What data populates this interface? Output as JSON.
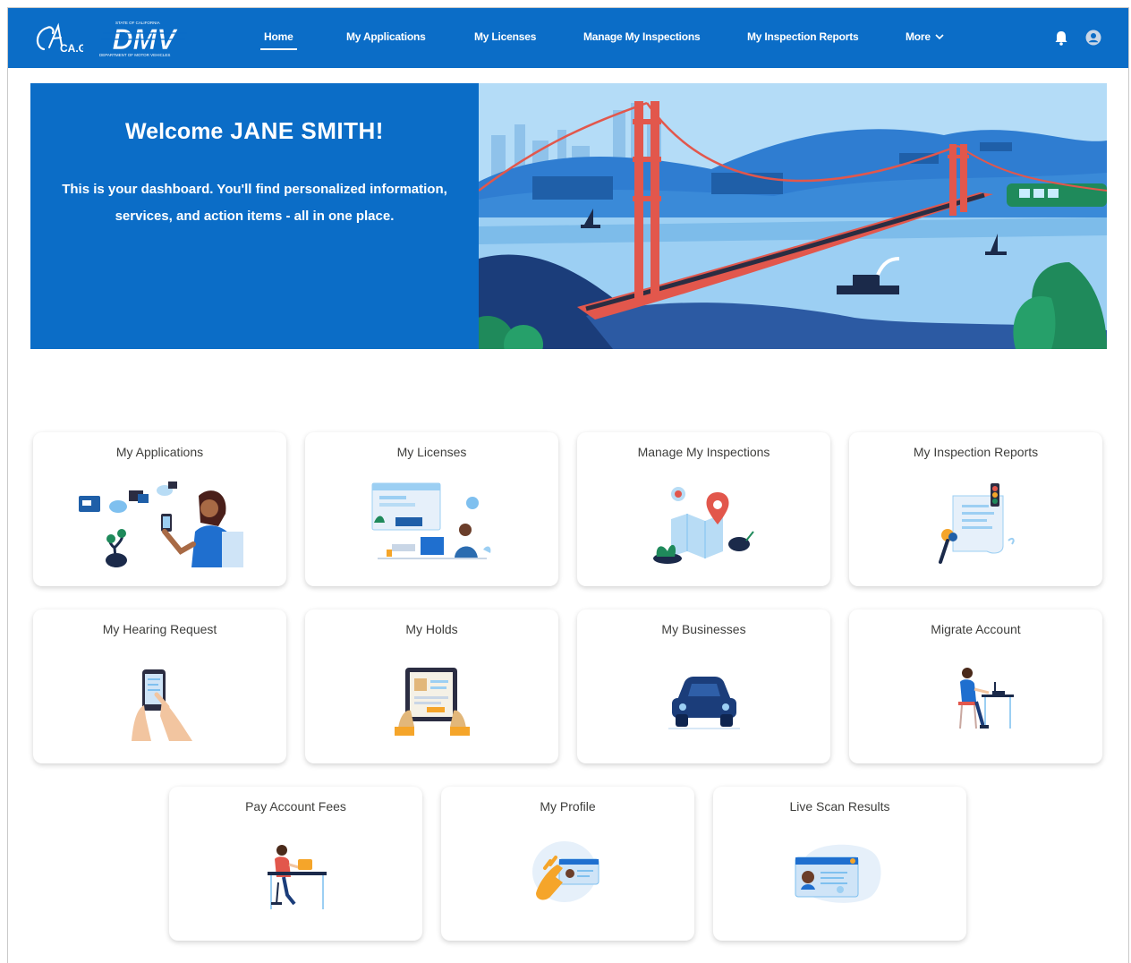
{
  "header": {
    "logo_ca": "CA.GOV",
    "logo_dmv": "DMV",
    "logo_dmv_top": "STATE OF CALIFORNIA",
    "logo_dmv_bottom": "DEPARTMENT OF MOTOR VEHICLES",
    "nav": [
      {
        "label": "Home",
        "active": true
      },
      {
        "label": "My Applications"
      },
      {
        "label": "My Licenses"
      },
      {
        "label": "Manage My Inspections"
      },
      {
        "label": "My Inspection Reports"
      },
      {
        "label": "More"
      }
    ],
    "icons": [
      "bell-icon",
      "user-avatar-icon"
    ]
  },
  "hero": {
    "welcome": "Welcome",
    "user_name": "JANE SMITH!",
    "subtitle": "This is your dashboard. You'll find personalized information, services, and action items - all in one place."
  },
  "tiles": [
    {
      "title": "My Applications"
    },
    {
      "title": "My Licenses"
    },
    {
      "title": "Manage My Inspections"
    },
    {
      "title": "My Inspection Reports"
    },
    {
      "title": "My Hearing Request"
    },
    {
      "title": "My Holds"
    },
    {
      "title": "My Businesses"
    },
    {
      "title": "Migrate Account"
    },
    {
      "title": "Pay Account Fees"
    },
    {
      "title": "My Profile"
    },
    {
      "title": "Live Scan Results"
    }
  ],
  "colors": {
    "brand_blue": "#0b6dc7",
    "bridge_red": "#e2574c",
    "accent_orange": "#f5a52a"
  }
}
